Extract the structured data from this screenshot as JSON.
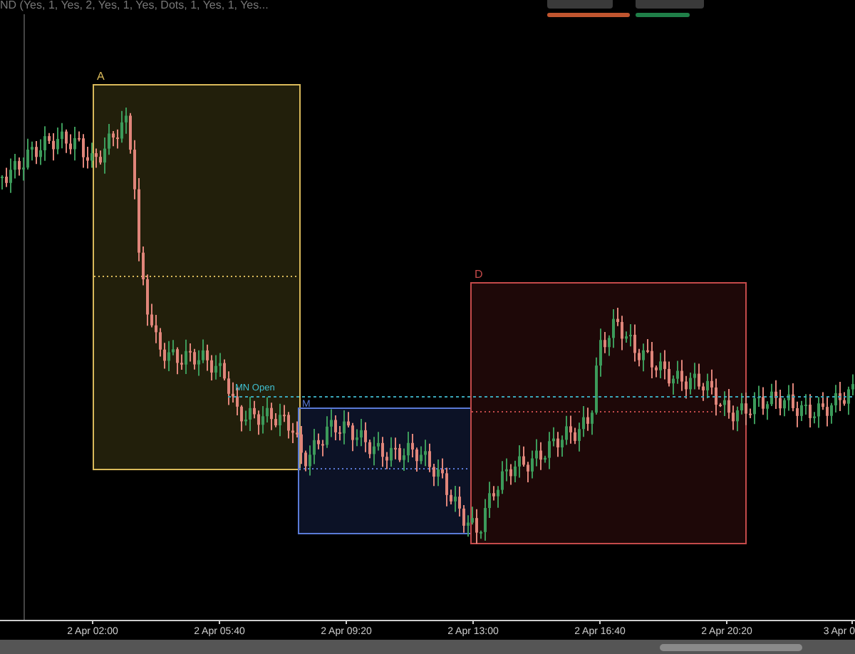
{
  "legend": "ND (Yes, 1, Yes, 2, Yes, 1, Yes, Dots, 1, Yes, 1, Yes...",
  "toolbar_buttons": [
    {
      "color": "#c0552f"
    },
    {
      "color": "#1f7f48"
    }
  ],
  "zones": [
    {
      "label": "A",
      "color": "#d9b95a"
    },
    {
      "label": "M",
      "color": "#5a7ad6"
    },
    {
      "label": "D",
      "color": "#c44a4a"
    }
  ],
  "level_line": {
    "label": "MN Open"
  },
  "x_axis": {
    "ticks": [
      "2 Apr 02:00",
      "2 Apr 05:40",
      "2 Apr 09:20",
      "2 Apr 13:00",
      "2 Apr 16:40",
      "2 Apr 20:20",
      "3 Apr 0"
    ]
  }
}
